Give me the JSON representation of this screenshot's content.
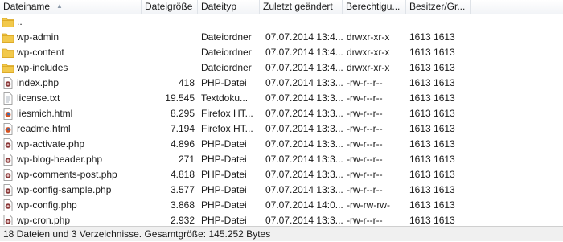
{
  "columns": [
    "Dateiname",
    "Dateigröße",
    "Dateityp",
    "Zuletzt geändert",
    "Berechtigu...",
    "Besitzer/Gr..."
  ],
  "files": [
    {
      "name": "..",
      "size": "",
      "type": "",
      "modified": "",
      "perms": "",
      "owner": "",
      "icon": "folder-icon"
    },
    {
      "name": "wp-admin",
      "size": "",
      "type": "Dateiordner",
      "modified": "07.07.2014 13:4...",
      "perms": "drwxr-xr-x",
      "owner": "1613 1613",
      "icon": "folder-icon"
    },
    {
      "name": "wp-content",
      "size": "",
      "type": "Dateiordner",
      "modified": "07.07.2014 13:4...",
      "perms": "drwxr-xr-x",
      "owner": "1613 1613",
      "icon": "folder-icon"
    },
    {
      "name": "wp-includes",
      "size": "",
      "type": "Dateiordner",
      "modified": "07.07.2014 13:4...",
      "perms": "drwxr-xr-x",
      "owner": "1613 1613",
      "icon": "folder-icon"
    },
    {
      "name": "index.php",
      "size": "418",
      "type": "PHP-Datei",
      "modified": "07.07.2014 13:3...",
      "perms": "-rw-r--r--",
      "owner": "1613 1613",
      "icon": "php-file-icon"
    },
    {
      "name": "license.txt",
      "size": "19.545",
      "type": "Textdoku...",
      "modified": "07.07.2014 13:3...",
      "perms": "-rw-r--r--",
      "owner": "1613 1613",
      "icon": "text-file-icon"
    },
    {
      "name": "liesmich.html",
      "size": "8.295",
      "type": "Firefox HT...",
      "modified": "07.07.2014 13:3...",
      "perms": "-rw-r--r--",
      "owner": "1613 1613",
      "icon": "html-file-icon"
    },
    {
      "name": "readme.html",
      "size": "7.194",
      "type": "Firefox HT...",
      "modified": "07.07.2014 13:3...",
      "perms": "-rw-r--r--",
      "owner": "1613 1613",
      "icon": "html-file-icon"
    },
    {
      "name": "wp-activate.php",
      "size": "4.896",
      "type": "PHP-Datei",
      "modified": "07.07.2014 13:3...",
      "perms": "-rw-r--r--",
      "owner": "1613 1613",
      "icon": "php-file-icon"
    },
    {
      "name": "wp-blog-header.php",
      "size": "271",
      "type": "PHP-Datei",
      "modified": "07.07.2014 13:3...",
      "perms": "-rw-r--r--",
      "owner": "1613 1613",
      "icon": "php-file-icon"
    },
    {
      "name": "wp-comments-post.php",
      "size": "4.818",
      "type": "PHP-Datei",
      "modified": "07.07.2014 13:3...",
      "perms": "-rw-r--r--",
      "owner": "1613 1613",
      "icon": "php-file-icon"
    },
    {
      "name": "wp-config-sample.php",
      "size": "3.577",
      "type": "PHP-Datei",
      "modified": "07.07.2014 13:3...",
      "perms": "-rw-r--r--",
      "owner": "1613 1613",
      "icon": "php-file-icon"
    },
    {
      "name": "wp-config.php",
      "size": "3.868",
      "type": "PHP-Datei",
      "modified": "07.07.2014 14:0...",
      "perms": "-rw-rw-rw-",
      "owner": "1613 1613",
      "icon": "php-file-icon"
    },
    {
      "name": "wp-cron.php",
      "size": "2.932",
      "type": "PHP-Datei",
      "modified": "07.07.2014 13:3...",
      "perms": "-rw-r--r--",
      "owner": "1613 1613",
      "icon": "php-file-icon"
    }
  ],
  "status": "18 Dateien und 3 Verzeichnisse. Gesamtgröße: 145.252 Bytes",
  "colors": {
    "folder": "#f2c94c",
    "folder_dark": "#d9a520",
    "php": "#8a3a3a",
    "html": "#d9531e",
    "header_border": "#d6dbe2",
    "status_bg": "#f0f0f0"
  }
}
